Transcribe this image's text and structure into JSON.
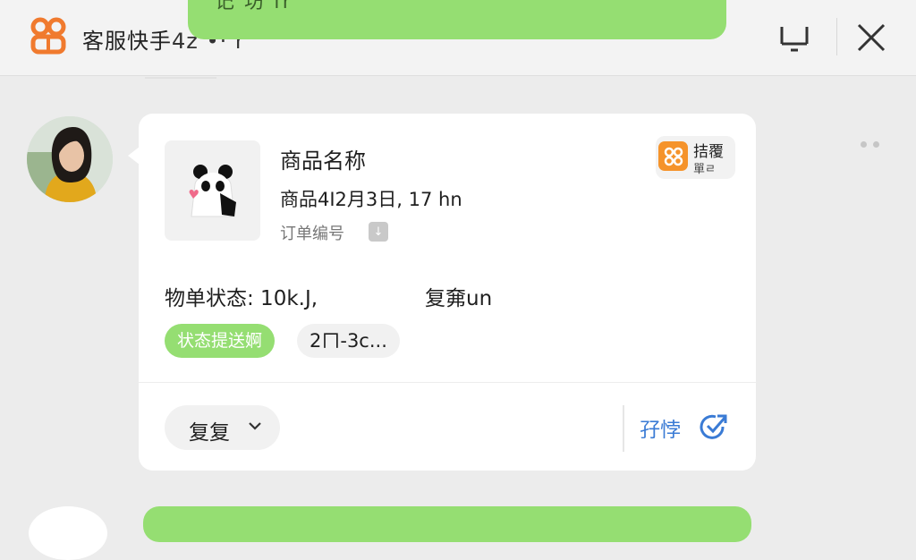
{
  "header": {
    "app_title": "客服快手",
    "title_suffix": "4z ",
    "title_suffix_red": "•· r",
    "top_bubble_text": "记 坊 fr",
    "colors": {
      "accent_green": "#95de72",
      "brand_orange": "#f07a2e",
      "link_blue": "#3a7bd5"
    }
  },
  "card": {
    "product_name": "商品名称",
    "product_meta": "商品4I2月3日, 17 hn",
    "order_label": "订单编号",
    "brand_badge": {
      "line1": "拮覆",
      "line2": "單ㄹ"
    },
    "status_line": "物单状态: 10k.J,",
    "status_extra": "复㚕un",
    "tag_green": "状态提送婀",
    "tag_gray": "2ㄇ-3c...",
    "dropdown_label": "复复",
    "action_link": "孖悖"
  },
  "icons": {
    "logo": "kuaishou-logo-icon",
    "minimize": "minimize-icon",
    "close": "close-icon",
    "copy": "copy-icon",
    "chevron": "chevron-down-icon",
    "action": "share-check-icon",
    "more": "more-dots-icon"
  }
}
